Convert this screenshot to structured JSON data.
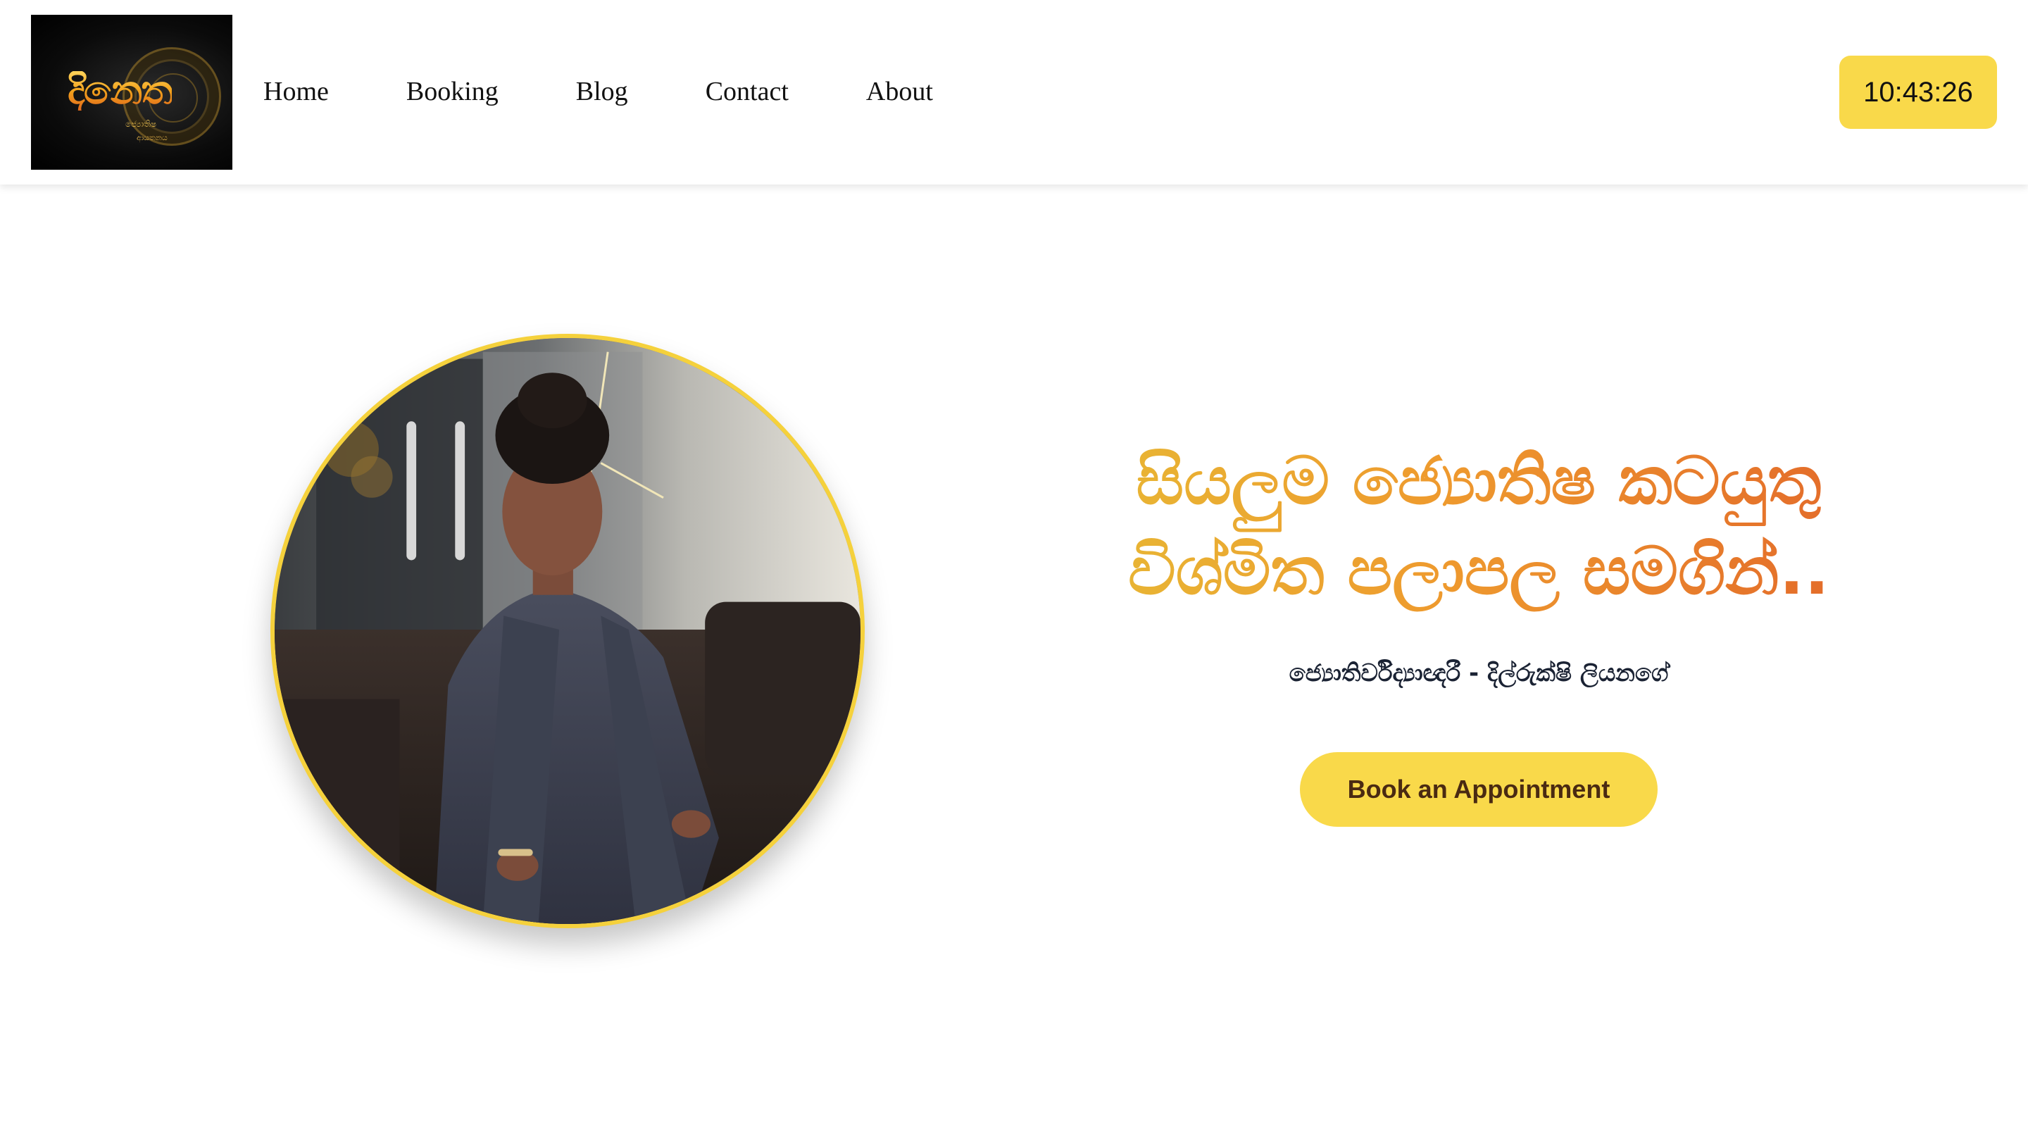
{
  "header": {
    "logo": {
      "text": "දිනෙත",
      "sub": "ජ්‍යොතිෂ",
      "sub2": "ආයතනය"
    },
    "nav": [
      {
        "label": "Home"
      },
      {
        "label": "Booking"
      },
      {
        "label": "Blog"
      },
      {
        "label": "Contact"
      },
      {
        "label": "About"
      }
    ],
    "clock": "10:43:26"
  },
  "hero": {
    "headline_line1": "සියලුම ජ්‍යොතිෂ කටයුතු",
    "headline_line2": "විශ්මිත පලාපල සමගින්..",
    "byline": "ජ්‍යොතිර්විද්‍යාඥරී - දිල්රුක්ෂි ලියනගේ",
    "cta_label": "Book an Appointment"
  },
  "colors": {
    "accent_yellow": "#f9d94a",
    "ring_yellow": "#f5d13c",
    "headline_gradient_start": "#e8b634",
    "headline_gradient_end": "#e36a2a",
    "cta_text": "#4a2a12"
  }
}
